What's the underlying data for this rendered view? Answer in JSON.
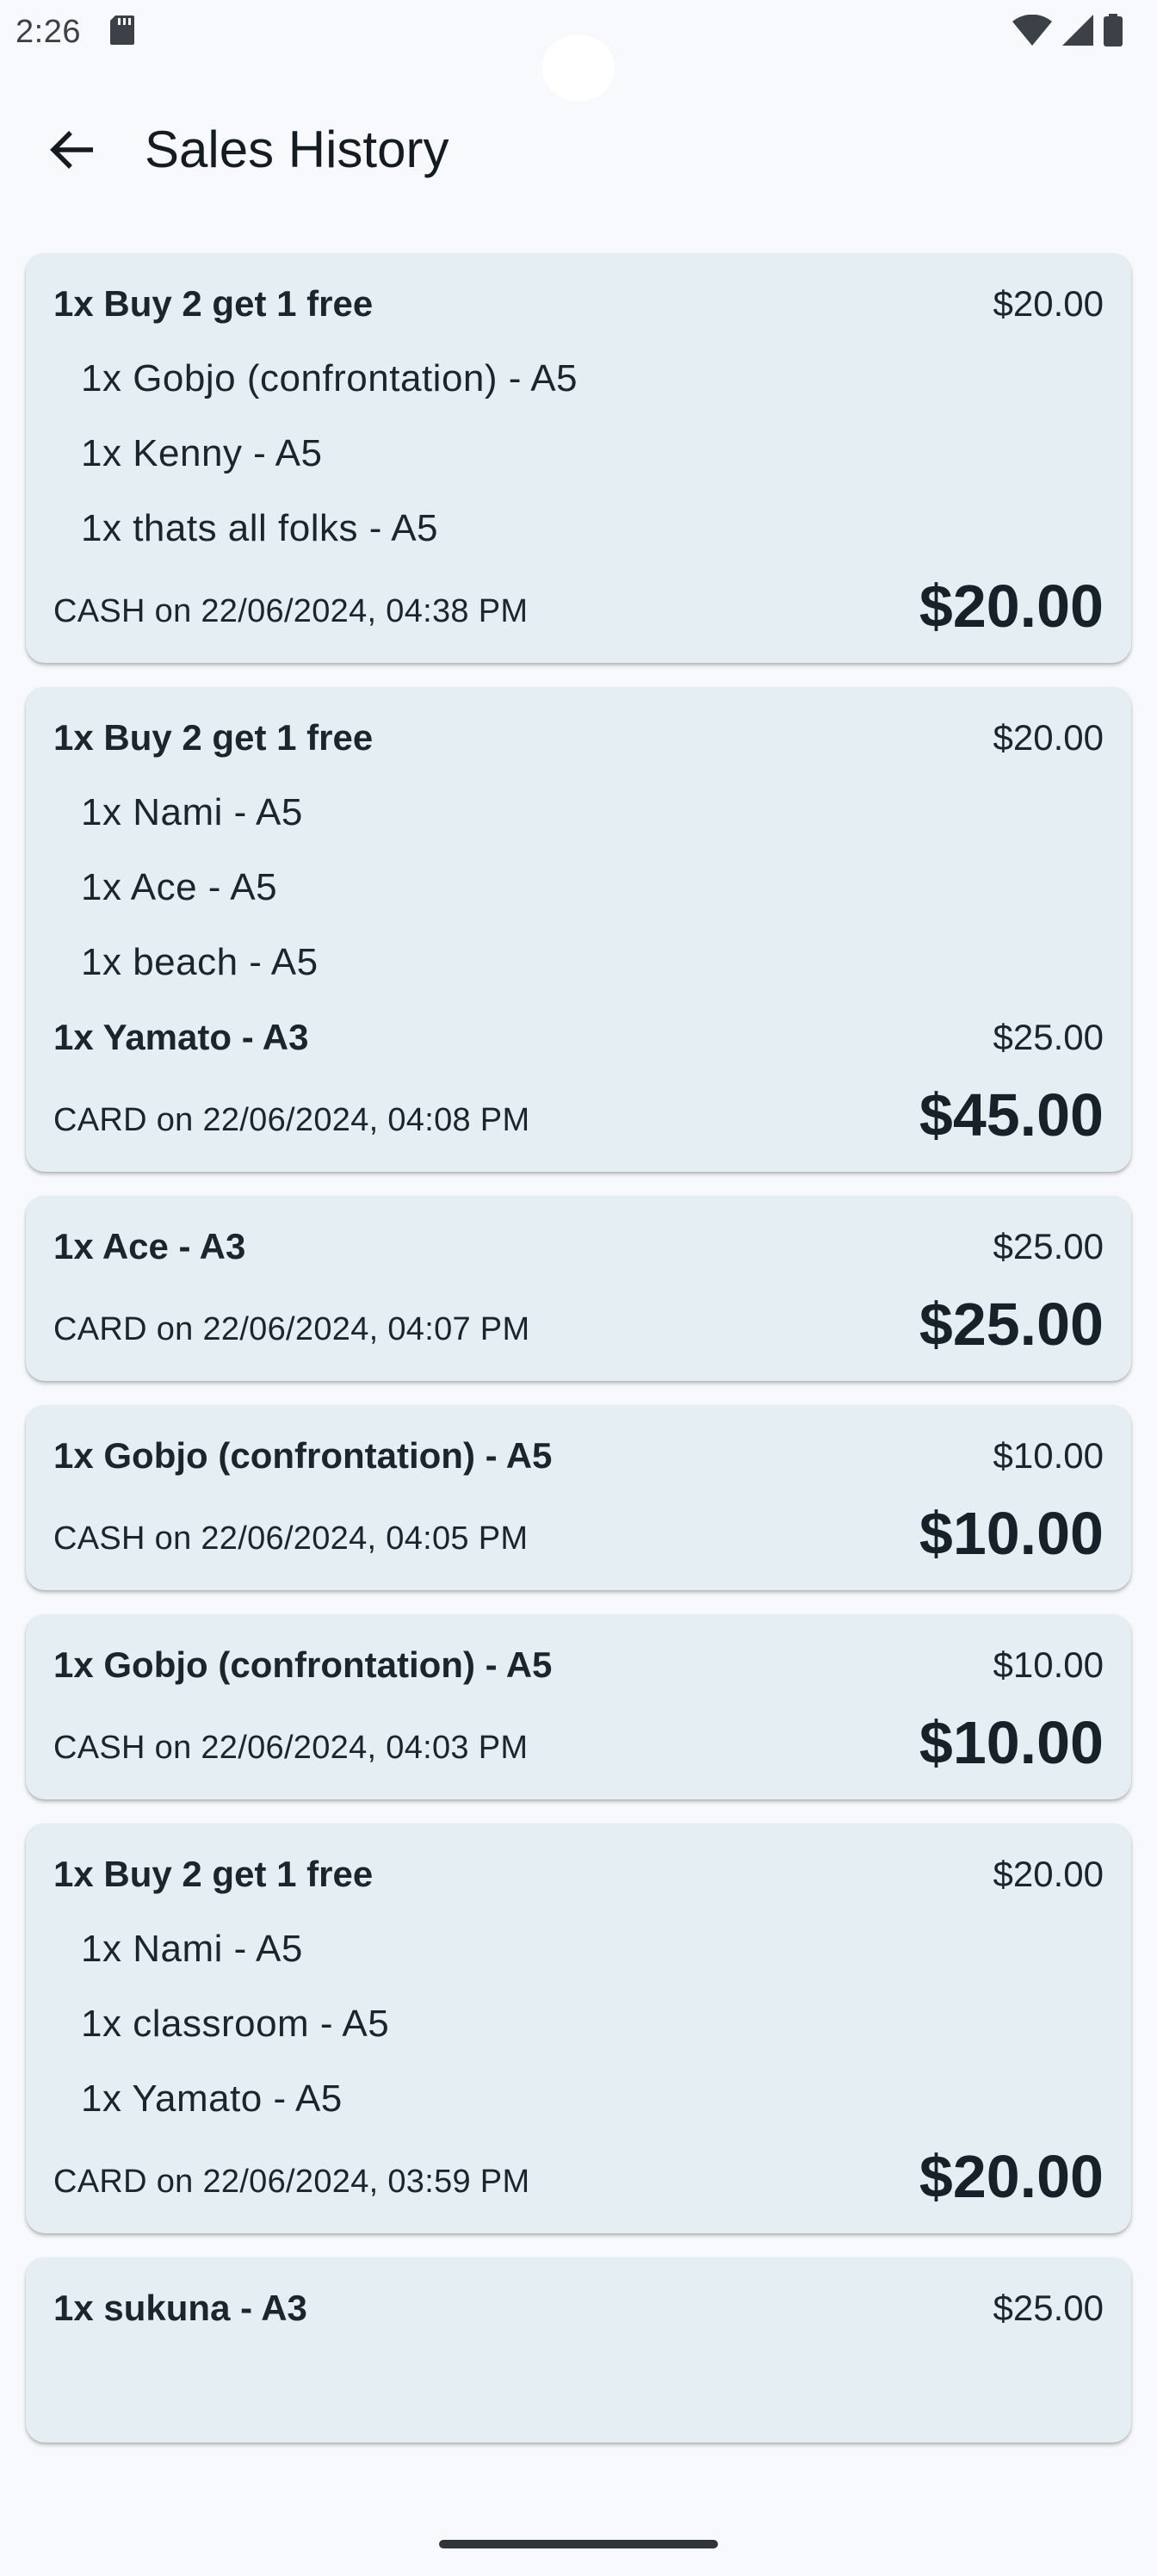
{
  "status_bar": {
    "time": "2:26"
  },
  "app_bar": {
    "title": "Sales History",
    "back_icon": "arrow-back-icon"
  },
  "sales": [
    {
      "lines": [
        {
          "name": "1x Buy 2 get 1 free",
          "price": "$20.00",
          "sub_items": [
            "1x Gobjo (confrontation) - A5",
            "1x Kenny - A5",
            "1x thats all folks - A5"
          ]
        }
      ],
      "payment": "CASH on 22/06/2024, 04:38 PM",
      "total": "$20.00"
    },
    {
      "lines": [
        {
          "name": "1x Buy 2 get 1 free",
          "price": "$20.00",
          "sub_items": [
            "1x Nami - A5",
            "1x Ace - A5",
            "1x beach - A5"
          ]
        },
        {
          "name": "1x Yamato - A3",
          "price": "$25.00",
          "sub_items": []
        }
      ],
      "payment": "CARD on 22/06/2024, 04:08 PM",
      "total": "$45.00"
    },
    {
      "lines": [
        {
          "name": "1x Ace - A3",
          "price": "$25.00",
          "sub_items": []
        }
      ],
      "payment": "CARD on 22/06/2024, 04:07 PM",
      "total": "$25.00"
    },
    {
      "lines": [
        {
          "name": "1x Gobjo (confrontation) - A5",
          "price": "$10.00",
          "sub_items": []
        }
      ],
      "payment": "CASH on 22/06/2024, 04:05 PM",
      "total": "$10.00"
    },
    {
      "lines": [
        {
          "name": "1x Gobjo (confrontation) - A5",
          "price": "$10.00",
          "sub_items": []
        }
      ],
      "payment": "CASH on 22/06/2024, 04:03 PM",
      "total": "$10.00"
    },
    {
      "lines": [
        {
          "name": "1x Buy 2 get 1 free",
          "price": "$20.00",
          "sub_items": [
            "1x Nami - A5",
            "1x classroom - A5",
            "1x Yamato - A5"
          ]
        }
      ],
      "payment": "CARD on 22/06/2024, 03:59 PM",
      "total": "$20.00"
    },
    {
      "lines": [
        {
          "name": "1x sukuna - A3",
          "price": "$25.00",
          "sub_items": []
        }
      ],
      "payment": "",
      "total": ""
    }
  ],
  "colors": {
    "background": "#f7f9fd",
    "card": "#e5eef2",
    "text": "#1b252c"
  }
}
